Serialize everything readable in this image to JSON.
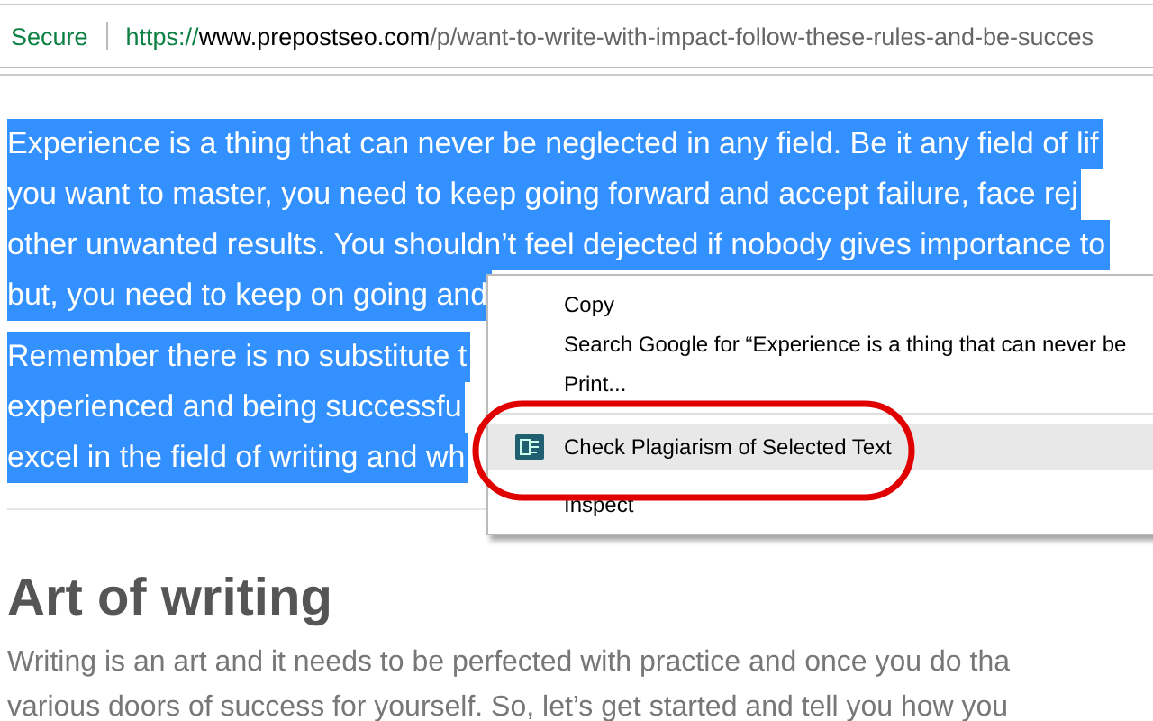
{
  "address_bar": {
    "security": "Secure",
    "url_scheme": "https://",
    "url_host": "www.prepostseo.com",
    "url_path": "/p/want-to-write-with-impact-follow-these-rules-and-be-succes"
  },
  "selected_paragraphs": [
    [
      "Experience is a thing that can never be neglected in any field. Be it any field of lif",
      "you want to master, you need to keep going forward and accept failure, face rej",
      "other unwanted results. You shouldn’t feel dejected if nobody gives importance to",
      "but, you need to keep on going and"
    ],
    [
      "Remember there is no substitute t",
      "experienced and being successfu",
      "excel in the field of writing and wh"
    ]
  ],
  "context_menu": {
    "items": [
      {
        "kind": "plain",
        "label": "Copy",
        "selected": false
      },
      {
        "kind": "plain",
        "label": "Search Google for “Experience is a thing that can never be",
        "selected": false
      },
      {
        "kind": "plain",
        "label": "Print...",
        "selected": false
      },
      {
        "kind": "extension",
        "label": "Check Plagiarism of Selected Text",
        "selected": true,
        "annotated": true
      },
      {
        "kind": "plain",
        "label": "Inspect",
        "selected": false
      }
    ]
  },
  "heading": "Art of writing",
  "body_lines": [
    "Writing is an art and it needs to be perfected with practice and once you do tha",
    "various doors of success for yourself. So, let’s get started and tell you how you"
  ]
}
